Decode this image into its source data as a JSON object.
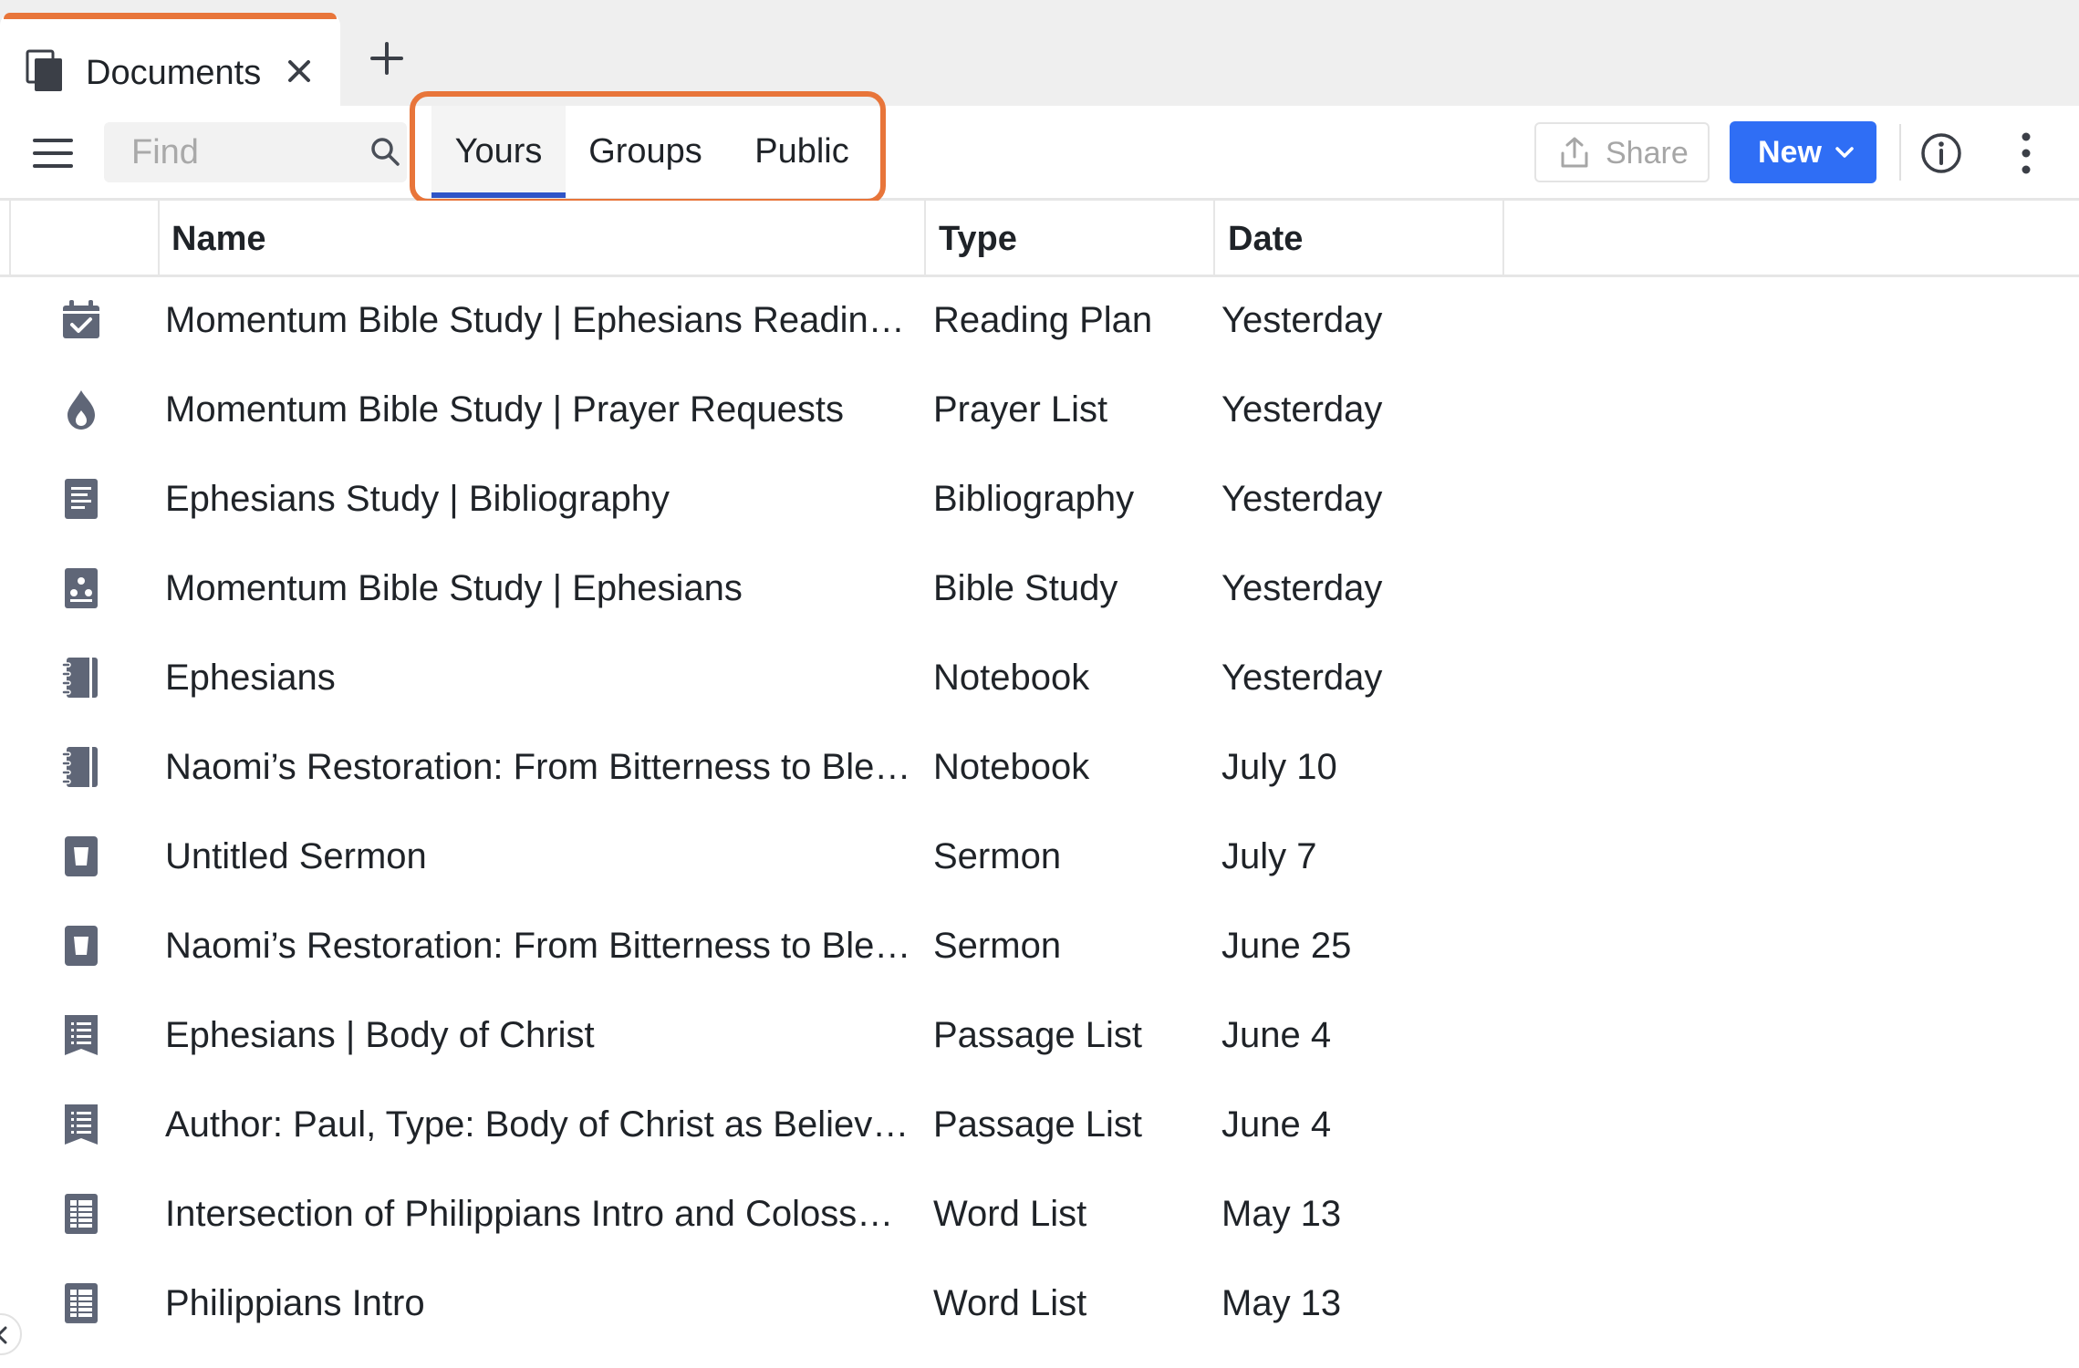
{
  "tab": {
    "label": "Documents"
  },
  "toolbar": {
    "find_placeholder": "Find",
    "scopes": [
      {
        "label": "Yours",
        "active": true
      },
      {
        "label": "Groups",
        "active": false
      },
      {
        "label": "Public",
        "active": false
      }
    ],
    "share_label": "Share",
    "new_label": "New"
  },
  "columns": {
    "name": "Name",
    "type": "Type",
    "date": "Date"
  },
  "rows": [
    {
      "icon": "reading-plan-icon",
      "name": "Momentum Bible Study | Ephesians Readin…",
      "type": "Reading Plan",
      "date": "Yesterday"
    },
    {
      "icon": "prayer-list-icon",
      "name": "Momentum Bible Study | Prayer Requests",
      "type": "Prayer List",
      "date": "Yesterday"
    },
    {
      "icon": "bibliography-icon",
      "name": "Ephesians Study | Bibliography",
      "type": "Bibliography",
      "date": "Yesterday"
    },
    {
      "icon": "bible-study-icon",
      "name": "Momentum Bible Study | Ephesians",
      "type": "Bible Study",
      "date": "Yesterday"
    },
    {
      "icon": "notebook-icon",
      "name": "Ephesians",
      "type": "Notebook",
      "date": "Yesterday"
    },
    {
      "icon": "notebook-icon",
      "name": "Naomi’s Restoration: From Bitterness to Ble…",
      "type": "Notebook",
      "date": "July 10"
    },
    {
      "icon": "sermon-icon",
      "name": "Untitled Sermon",
      "type": "Sermon",
      "date": "July 7"
    },
    {
      "icon": "sermon-icon",
      "name": "Naomi’s Restoration: From Bitterness to Ble…",
      "type": "Sermon",
      "date": "June 25"
    },
    {
      "icon": "passage-list-icon",
      "name": "Ephesians | Body of Christ",
      "type": "Passage List",
      "date": "June 4"
    },
    {
      "icon": "passage-list-icon",
      "name": "Author: Paul, Type: Body of Christ as Believ…",
      "type": "Passage List",
      "date": "June 4"
    },
    {
      "icon": "word-list-icon",
      "name": "Intersection of Philippians Intro and Coloss…",
      "type": "Word List",
      "date": "May 13"
    },
    {
      "icon": "word-list-icon",
      "name": "Philippians Intro",
      "type": "Word List",
      "date": "May 13"
    }
  ],
  "colors": {
    "accent_orange": "#e8753a",
    "primary_blue": "#2f6ef5",
    "icon_gray": "#5f6677",
    "active_underline": "#2f55c7"
  }
}
